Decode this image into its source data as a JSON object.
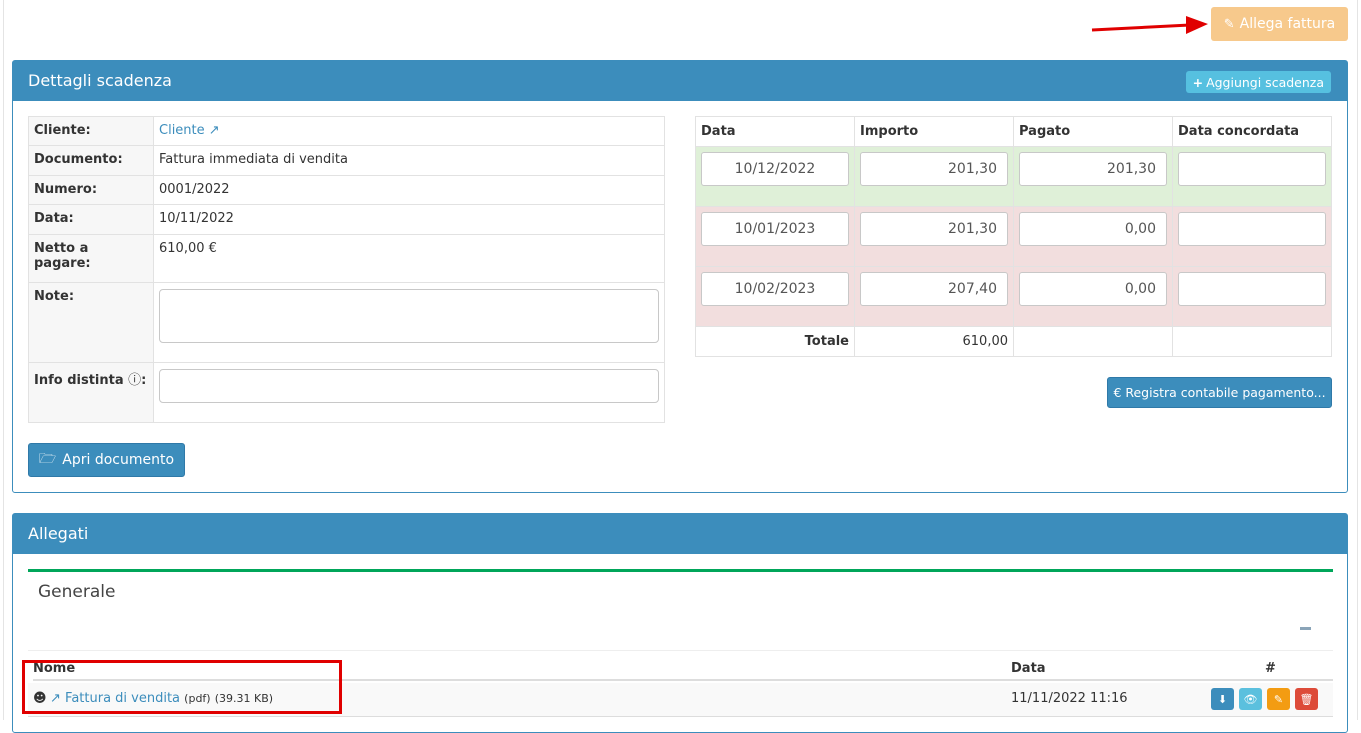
{
  "top": {
    "allega_label": "Allega fattura"
  },
  "details": {
    "title": "Dettagli scadenza",
    "add_label": "Aggiungi scadenza",
    "info": {
      "cliente_label": "Cliente:",
      "cliente_value": "Cliente",
      "documento_label": "Documento:",
      "documento_value": "Fattura immediata di vendita",
      "numero_label": "Numero:",
      "numero_value": "0001/2022",
      "data_label": "Data:",
      "data_value": "10/11/2022",
      "netto_label": "Netto a pagare:",
      "netto_value": "610,00 €",
      "note_label": "Note:",
      "info_distinta_label": "Info distinta"
    },
    "open_doc_label": "Apri documento",
    "schedule": {
      "headers": [
        "Data",
        "Importo",
        "Pagato",
        "Data concordata"
      ],
      "rows": [
        {
          "data": "10/12/2022",
          "importo": "201,30",
          "pagato": "201,30",
          "concordata": ""
        },
        {
          "data": "10/01/2023",
          "importo": "201,30",
          "pagato": "0,00",
          "concordata": ""
        },
        {
          "data": "10/02/2023",
          "importo": "207,40",
          "pagato": "0,00",
          "concordata": ""
        }
      ],
      "total_label": "Totale",
      "total_value": "610,00"
    },
    "register_label": "€ Registra contabile pagamento..."
  },
  "attachments": {
    "title": "Allegati",
    "group_title": "Generale",
    "col_nome": "Nome",
    "col_data": "Data",
    "col_actions": "#",
    "files": [
      {
        "name": "Fattura di vendita",
        "ext": "(pdf)",
        "size": "(39.31 KB)",
        "date": "11/11/2022 11:16"
      }
    ]
  },
  "colors": {
    "primary": "#3c8dbc",
    "warning_light": "#f7c98c",
    "info": "#56c0e0",
    "success_bg": "#dff0d8",
    "danger_bg": "#f2dede",
    "green_border": "#00a65a",
    "annotation_red": "#e00000"
  }
}
